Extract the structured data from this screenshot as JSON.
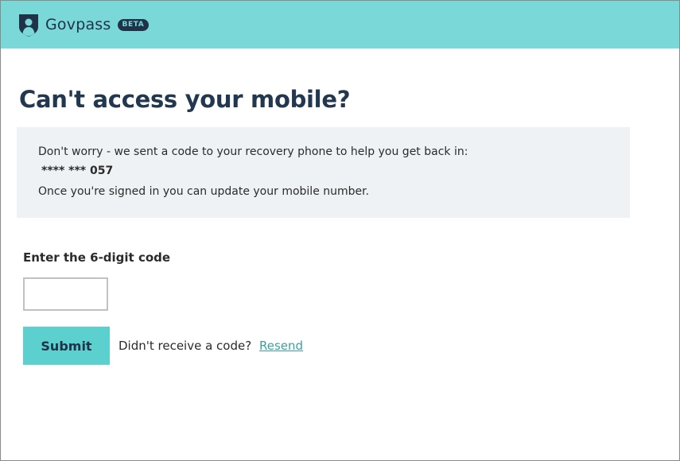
{
  "header": {
    "brand": "Govpass",
    "badge": "BETA",
    "color": "#7bd8d8",
    "logo_icon": "shield-person-icon"
  },
  "page": {
    "title": "Can't access your mobile?"
  },
  "notice": {
    "line1": "Don't worry - we sent a code to your recovery phone to help you get back in:",
    "phone": "**** *** 057",
    "line3": "Once you're signed in you can update your mobile number."
  },
  "form": {
    "code_label": "Enter the 6-digit code",
    "code_value": "",
    "submit_label": "Submit",
    "submit_color": "#5ccfcf",
    "resend_prompt": "Didn't receive a code?",
    "resend_link": "Resend",
    "link_color": "#3f9f9f"
  }
}
